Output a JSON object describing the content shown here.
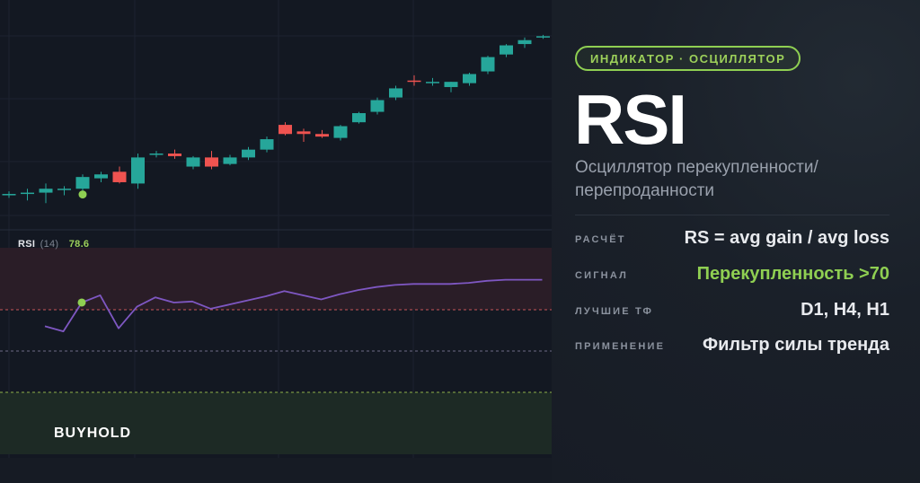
{
  "colors": {
    "accent": "#8fcf52",
    "bull": "#26a69a",
    "bear": "#ef5350",
    "rsi_line": "#7e57c2",
    "panel": "#131822",
    "overbought_zone": "#2a1d27",
    "oversold_zone": "#1d2a25"
  },
  "price_chart": {
    "candles": [
      {
        "o": 100,
        "h": 100.3,
        "l": 99.8,
        "c": 100.1
      },
      {
        "o": 100.1,
        "h": 100.5,
        "l": 99.6,
        "c": 100.2
      },
      {
        "o": 100.2,
        "h": 100.9,
        "l": 99.4,
        "c": 100.5
      },
      {
        "o": 100.4,
        "h": 100.7,
        "l": 100,
        "c": 100.5
      },
      {
        "o": 100.5,
        "h": 101.6,
        "l": 100.2,
        "c": 101.4
      },
      {
        "o": 101.3,
        "h": 101.8,
        "l": 101,
        "c": 101.6
      },
      {
        "o": 101.8,
        "h": 102.2,
        "l": 100.9,
        "c": 101
      },
      {
        "o": 100.9,
        "h": 103.2,
        "l": 100.5,
        "c": 102.9
      },
      {
        "o": 103.2,
        "h": 103.4,
        "l": 102.9,
        "c": 103.2
      },
      {
        "o": 103.2,
        "h": 103.5,
        "l": 102.8,
        "c": 103
      },
      {
        "o": 102.2,
        "h": 103,
        "l": 102,
        "c": 102.9
      },
      {
        "o": 102.9,
        "h": 103.4,
        "l": 102,
        "c": 102.2
      },
      {
        "o": 102.4,
        "h": 103.1,
        "l": 102.3,
        "c": 102.9
      },
      {
        "o": 102.9,
        "h": 103.7,
        "l": 102.7,
        "c": 103.5
      },
      {
        "o": 103.5,
        "h": 104.5,
        "l": 103.3,
        "c": 104.3
      },
      {
        "o": 105.4,
        "h": 105.6,
        "l": 104.6,
        "c": 104.7
      },
      {
        "o": 104.9,
        "h": 105.1,
        "l": 104.1,
        "c": 104.7
      },
      {
        "o": 104.7,
        "h": 105,
        "l": 104.4,
        "c": 104.5
      },
      {
        "o": 104.4,
        "h": 105.4,
        "l": 104.2,
        "c": 105.3
      },
      {
        "o": 105.6,
        "h": 106.4,
        "l": 105.5,
        "c": 106.3
      },
      {
        "o": 106.4,
        "h": 107.5,
        "l": 106.2,
        "c": 107.3
      },
      {
        "o": 107.5,
        "h": 108.4,
        "l": 107.3,
        "c": 108.2
      },
      {
        "o": 108.8,
        "h": 109.2,
        "l": 108.4,
        "c": 108.7
      },
      {
        "o": 108.7,
        "h": 109,
        "l": 108.4,
        "c": 108.7
      },
      {
        "o": 108.3,
        "h": 108.7,
        "l": 107.9,
        "c": 108.7
      },
      {
        "o": 108.6,
        "h": 109.4,
        "l": 108.4,
        "c": 109.3
      },
      {
        "o": 109.5,
        "h": 110.7,
        "l": 109.3,
        "c": 110.6
      },
      {
        "o": 110.8,
        "h": 111.6,
        "l": 110.6,
        "c": 111.5
      },
      {
        "o": 111.6,
        "h": 112.1,
        "l": 111.3,
        "c": 111.9
      },
      {
        "o": 112.1,
        "h": 112.3,
        "l": 112,
        "c": 112.2
      }
    ],
    "signal_index": 4
  },
  "rsi": {
    "name": "RSI",
    "period": "(14)",
    "value": "78.6",
    "upper": 70,
    "middle": 50,
    "lower": 30,
    "range": [
      0,
      100
    ],
    "values": [
      62,
      59.5,
      73.5,
      77,
      61,
      71.5,
      76,
      73.5,
      74,
      70.5,
      72.5,
      74.5,
      76.5,
      79,
      77,
      75,
      77.5,
      79.5,
      81,
      82,
      82.5,
      82.5,
      82.5,
      83,
      84,
      84.5,
      84.5,
      84.5
    ],
    "signal_index": 2
  },
  "logo": {
    "text": "BUYHOLD"
  },
  "info": {
    "tag": "Индикатор · Осциллятор",
    "title": "RSI",
    "subtitle": "Осциллятор перекупленности/ перепроданности",
    "rows": [
      {
        "key": "Расчёт",
        "value": "RS = avg gain / avg loss"
      },
      {
        "key": "Сигнал",
        "value": "Перекупленность >70"
      },
      {
        "key": "Лучшие ТФ",
        "value": "D1, H4, H1"
      },
      {
        "key": "Применение",
        "value": "Фильтр силы тренда"
      }
    ]
  }
}
